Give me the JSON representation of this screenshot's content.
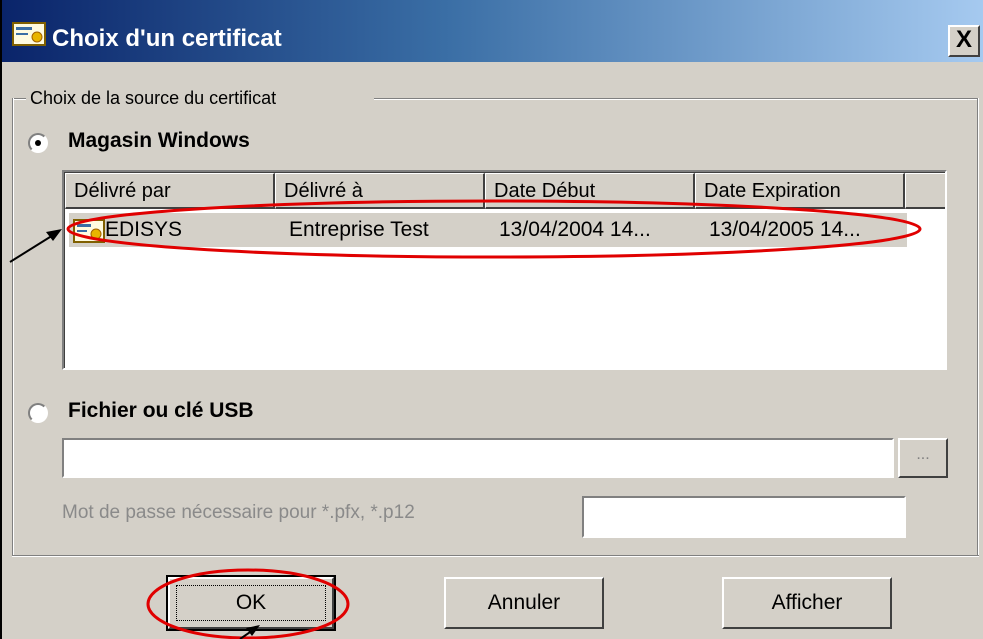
{
  "window": {
    "title": "Choix d'un certificat",
    "close_label": "X"
  },
  "source_group": {
    "label": "Choix de la source du certificat"
  },
  "radio_store": {
    "label": "Magasin Windows",
    "selected": true
  },
  "radio_file": {
    "label": "Fichier ou clé USB",
    "selected": false
  },
  "cert_list": {
    "columns": [
      "Délivré par",
      "Délivré à",
      "Date Début",
      "Date Expiration"
    ],
    "rows": [
      {
        "issued_by": "EDISYS",
        "issued_to": "Entreprise Test",
        "start": "13/04/2004 14...",
        "expiry": "13/04/2005 14..."
      }
    ]
  },
  "file_path": {
    "value": "",
    "browse_label": "..."
  },
  "password": {
    "label": "Mot de passe nécessaire pour *.pfx, *.p12",
    "value": ""
  },
  "buttons": {
    "ok": "OK",
    "cancel": "Annuler",
    "show": "Afficher"
  },
  "colors": {
    "title_start": "#0a246a",
    "title_end": "#a6caf0",
    "dialog_bg": "#d4d0c8",
    "annotation": "#e00000"
  },
  "icons": {
    "title": "certificate-icon",
    "row": "certificate-icon"
  }
}
